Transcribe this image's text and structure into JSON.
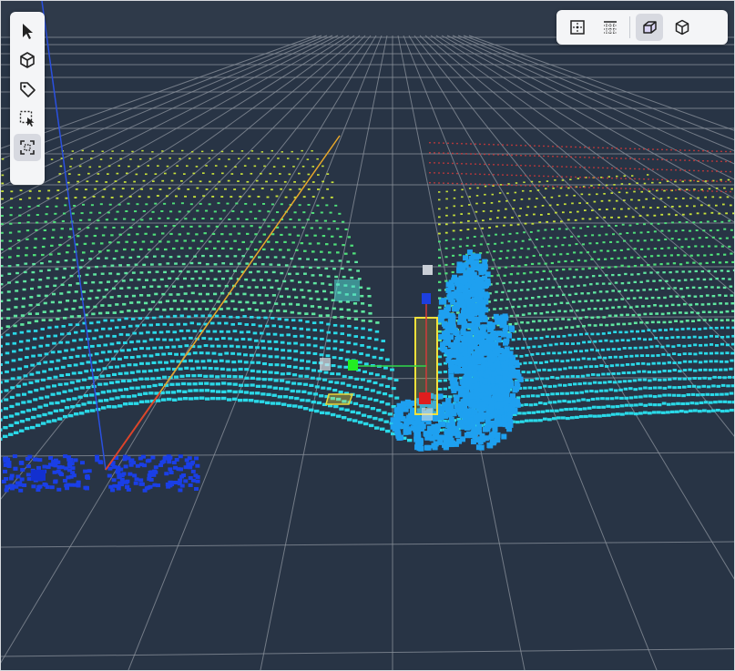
{
  "toolbar_left": {
    "tools": [
      {
        "id": "select",
        "icon": "cursor-icon"
      },
      {
        "id": "cuboid",
        "icon": "cube-icon"
      },
      {
        "id": "tag",
        "icon": "tag-icon"
      },
      {
        "id": "region-select",
        "icon": "lasso-select-icon"
      },
      {
        "id": "fit-frame",
        "icon": "frame-icon",
        "active": true
      }
    ]
  },
  "toolbar_top": {
    "views": [
      {
        "id": "top-view",
        "icon": "top-view-icon"
      },
      {
        "id": "grid-view",
        "icon": "grid-view-icon"
      },
      {
        "id": "perspective-view",
        "icon": "perspective-box-icon",
        "active": true
      },
      {
        "id": "3d-view",
        "icon": "box-3d-icon"
      }
    ]
  },
  "colors": {
    "background": "#283445",
    "grid": "#8c939d",
    "point_near": "#2ad9e8",
    "point_mid": "#4fe07a",
    "point_far": "#c8e23a",
    "point_red": "#d23a3a",
    "object": "#1ea0f0",
    "bbox": "#f2e13a",
    "axis_x": "#e0402a",
    "axis_y": "#e8a82a",
    "axis_z": "#2a50e0"
  }
}
